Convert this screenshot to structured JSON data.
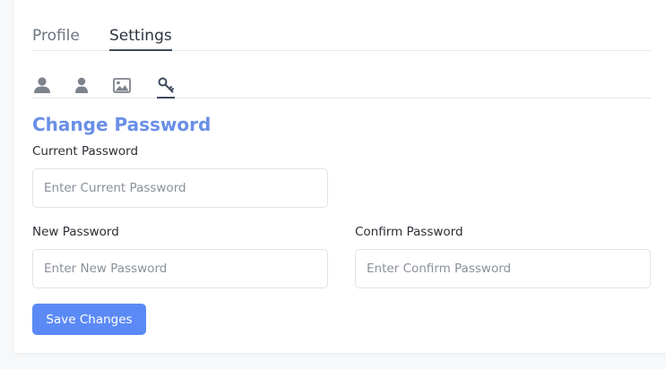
{
  "tabs": [
    {
      "label": "Profile",
      "active": false
    },
    {
      "label": "Settings",
      "active": true
    }
  ],
  "subtabs": [
    {
      "icon": "user-icon",
      "active": false
    },
    {
      "icon": "person-icon",
      "active": false
    },
    {
      "icon": "image-icon",
      "active": false
    },
    {
      "icon": "key-icon",
      "active": true
    }
  ],
  "form": {
    "title": "Change Password",
    "current_label": "Current Password",
    "current_placeholder": "Enter Current Password",
    "new_label": "New Password",
    "new_placeholder": "Enter New Password",
    "confirm_label": "Confirm Password",
    "confirm_placeholder": "Enter Confirm Password",
    "submit_label": "Save Changes"
  },
  "colors": {
    "accent": "#5b8af6",
    "title": "#6a8fe6",
    "icon": "#7d838c"
  }
}
